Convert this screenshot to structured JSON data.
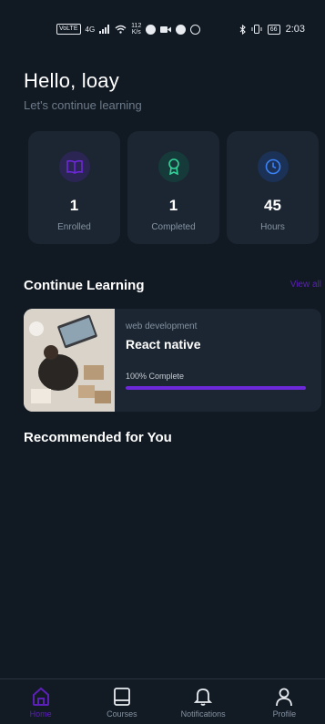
{
  "status_bar": {
    "left_badge": "VoLTE",
    "network": "4G",
    "speed_value": "112",
    "speed_unit": "K/s",
    "battery": "66",
    "time": "2:03"
  },
  "greeting": {
    "title": "Hello, loay",
    "subtitle": "Let's continue learning"
  },
  "stats": [
    {
      "value": "1",
      "label": "Enrolled",
      "icon": "book-icon",
      "color": "#6d28d9",
      "bg": "#2a2553"
    },
    {
      "value": "1",
      "label": "Completed",
      "icon": "award-icon",
      "color": "#34d399",
      "bg": "#163a3a"
    },
    {
      "value": "45",
      "label": "Hours",
      "icon": "clock-icon",
      "color": "#3b82f6",
      "bg": "#1b3155"
    }
  ],
  "continue_learning": {
    "title": "Continue Learning",
    "view_all": "View all",
    "course": {
      "category": "web development",
      "name": "React native",
      "progress_label": "100% Complete",
      "progress": 1.0
    }
  },
  "recommended": {
    "title": "Recommended for You"
  },
  "nav": {
    "items": [
      {
        "label": "Home",
        "icon": "home-icon",
        "active": true
      },
      {
        "label": "Courses",
        "icon": "book-icon",
        "active": false
      },
      {
        "label": "Notifications",
        "icon": "bell-icon",
        "active": false
      },
      {
        "label": "Profile",
        "icon": "user-icon",
        "active": false
      }
    ]
  },
  "colors": {
    "background": "#111923",
    "card": "#1c2632",
    "accent": "#6d28d9",
    "muted_text": "#8593a2"
  }
}
